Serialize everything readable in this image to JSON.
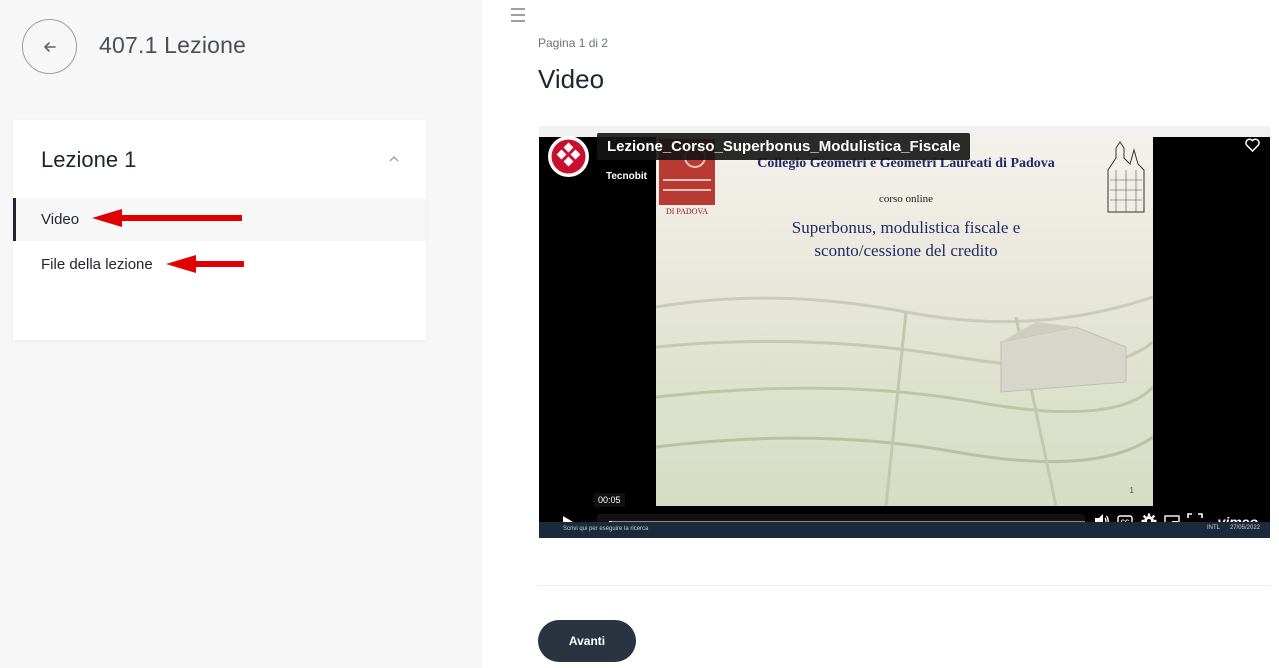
{
  "header": {
    "lesson_title": "407.1 Lezione"
  },
  "sidebar": {
    "card_title": "Lezione 1",
    "items": [
      {
        "label": "Video",
        "active": true
      },
      {
        "label": "File della lezione",
        "active": false
      }
    ]
  },
  "main": {
    "pagination": "Pagina 1 di 2",
    "title": "Video"
  },
  "video": {
    "title": "Lezione_Corso_Superbonus_Modulistica_Fiscale",
    "author": "Tecnobit",
    "current_time": "00:05",
    "progress_fraction": 0.006,
    "brand": "vimeo",
    "slide": {
      "header": "Collegio Geometri e Geometri Laureati di Padova",
      "subtitle": "corso online",
      "main_line1": "Superbonus, modulistica fiscale e",
      "main_line2": "sconto/cessione del credito",
      "logo_text": "DI PADOVA",
      "page_number": "1"
    },
    "taskbar": {
      "search": "Scrivi qui per eseguire la ricerca",
      "lang": "INTL",
      "date": "27/05/2022"
    }
  },
  "footer": {
    "next_label": "Avanti"
  },
  "colors": {
    "annotation_arrow": "#e00000",
    "button_bg": "#2a3441"
  }
}
